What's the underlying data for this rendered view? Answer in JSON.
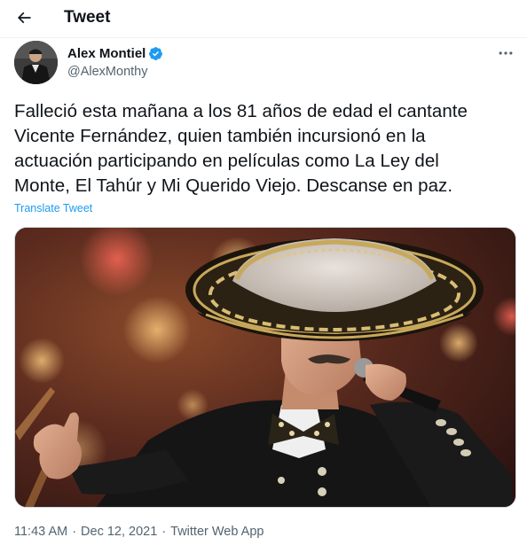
{
  "header": {
    "back_icon": "arrow-left-icon",
    "title": "Tweet"
  },
  "author": {
    "display_name": "Alex Montiel",
    "handle": "@AlexMonthy",
    "verified": true,
    "verified_icon": "verified-badge-icon",
    "verified_color": "#1d9bf0",
    "more_icon": "more-horizontal-icon"
  },
  "tweet": {
    "text_lines": [
      "Falleció esta mañana a los 81 años de edad el cantante",
      "Vicente Fernández, quien también incursionó en la",
      "actuación participando en películas como La Ley del",
      "Monte, El Tahúr y Mi Querido Viejo. Descanse en paz."
    ],
    "translate_label": "Translate Tweet",
    "link_color": "#1d9bf0"
  },
  "meta": {
    "time": "11:43 AM",
    "separator": "·",
    "date": "Dec 12, 2021",
    "source": "Twitter Web App"
  }
}
